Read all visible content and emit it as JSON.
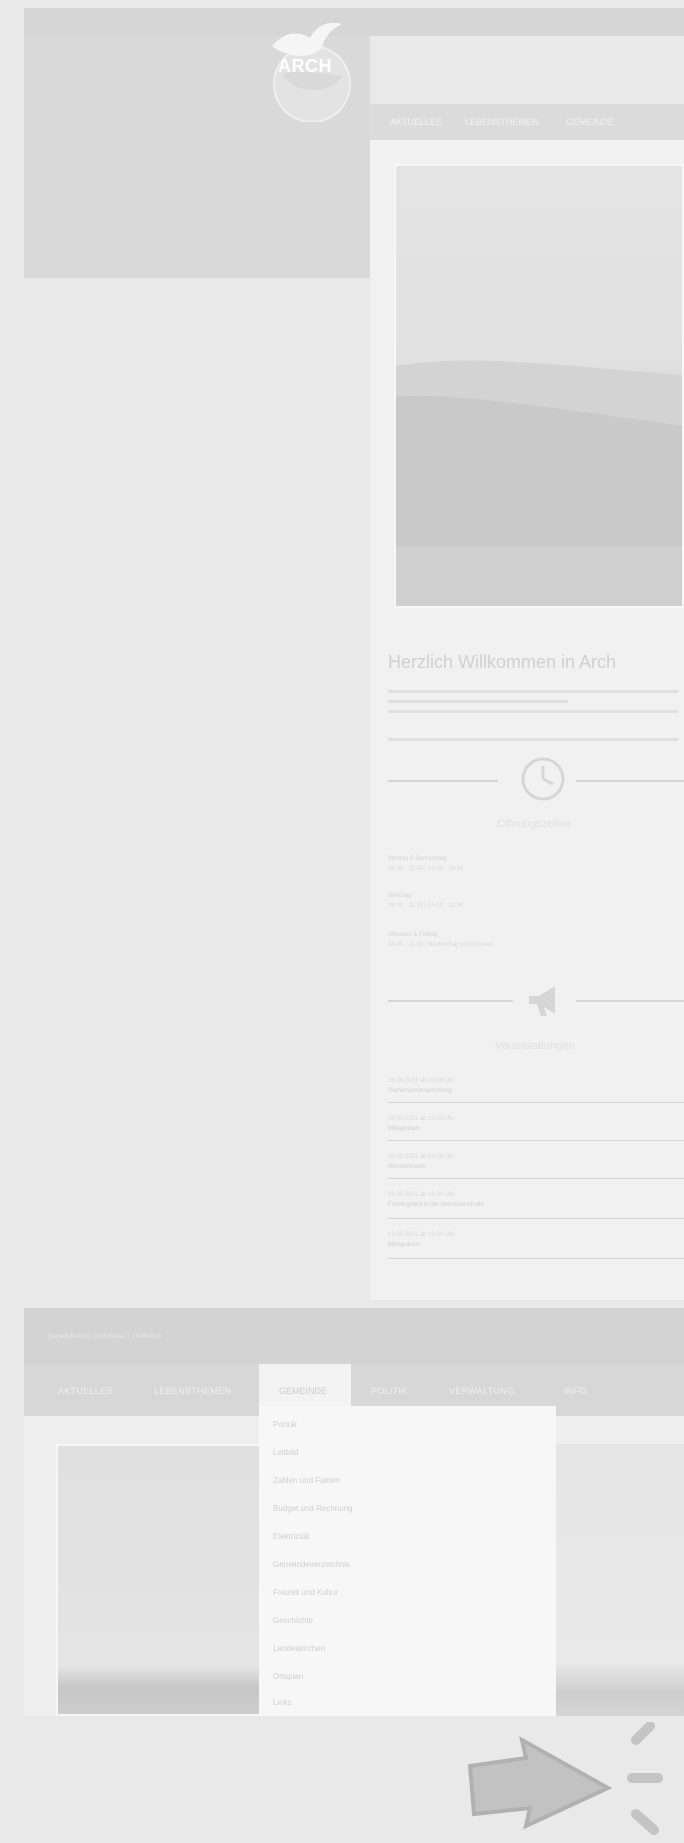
{
  "site": {
    "logo_text": "ARCH",
    "logo_mark": "dove-logo-icon"
  },
  "top_nav": {
    "items": [
      "AKTUELLES",
      "LEBENSTHEMEN",
      "GEMEINDE"
    ]
  },
  "welcome": {
    "title": "Herzlich Willkommen in Arch"
  },
  "opening_hours": {
    "icon": "clock-icon",
    "title": "Öffnungszeiten",
    "rows": [
      {
        "label": "Montag & Donnerstag",
        "value": "08.30 - 11.30 / 14.00 - 16.30"
      },
      {
        "label": "Dienstag",
        "value": "08.30 - 11.30 / 14.00 - 18.00"
      },
      {
        "label": "Mittwoch & Freitag",
        "value": "08.30 - 11.30 / Nachmittag geschlossen"
      }
    ]
  },
  "events": {
    "icon": "megaphone-icon",
    "title": "Veranstaltungen",
    "items": [
      {
        "date": "26.04.2021 ab 20.00 Uhr",
        "name": "Gemeindeversammlung"
      },
      {
        "date": "29.04.2021 ab 19.00 Uhr",
        "name": "Mittagstisch"
      },
      {
        "date": "05.05.2021 ab 09.00 Uhr",
        "name": "Wochenmarkt"
      },
      {
        "date": "08.05.2021 ab 10.00 Uhr",
        "name": "Frühlingsfest in der Mehrzweckhalle"
      },
      {
        "date": "12.05.2021 ab 12.00 Uhr",
        "name": "Mittagstisch"
      }
    ]
  },
  "footer": {
    "text": "Gemeinde Arch | Dorfstrasse 7 | 3296 Arch"
  },
  "main_nav": {
    "items": [
      "AKTUELLES",
      "LEBENSTHEMEN",
      "GEMEINDE",
      "POLITIK",
      "VERWALTUNG",
      "INFO"
    ],
    "active": "GEMEINDE"
  },
  "dropdown": {
    "items": [
      "Porträt",
      "Leitbild",
      "Zahlen und Fakten",
      "Budget und Rechnung",
      "Elektrizität",
      "Gemeindeverzeichnis",
      "Freizeit und Kultur",
      "Geschichte",
      "Landeskirchen",
      "Ortsplan",
      "Links"
    ]
  },
  "overlay": {
    "icon": "click-cursor-icon"
  }
}
